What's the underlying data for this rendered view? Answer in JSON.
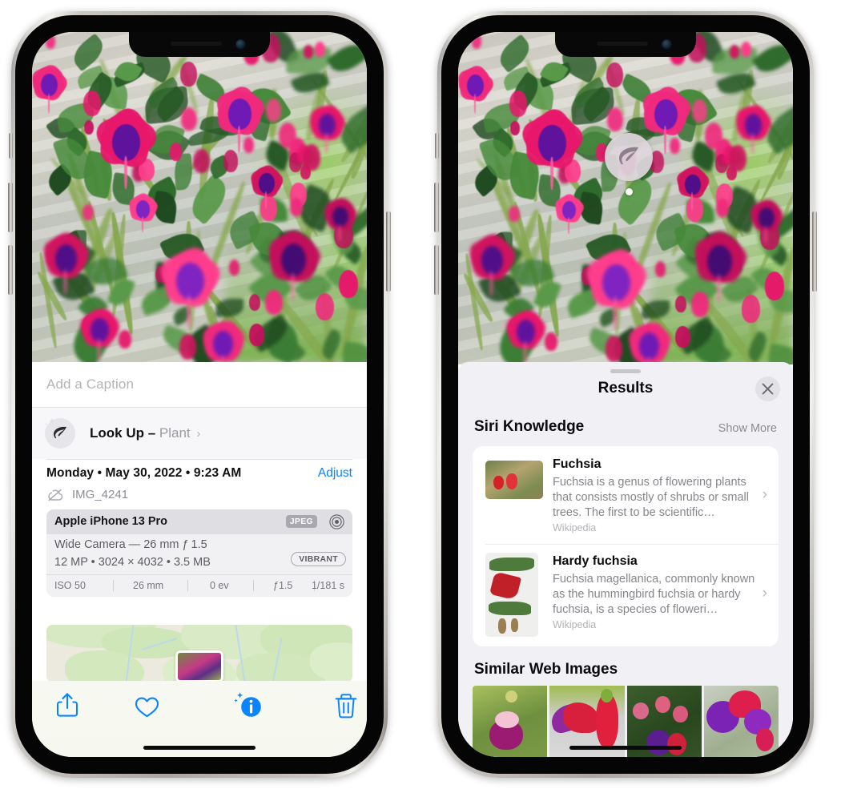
{
  "left_phone": {
    "name": "iPhone photo detail view",
    "caption": {
      "placeholder": "Add a Caption",
      "value": ""
    },
    "lookup": {
      "icon": "leaf-icon",
      "label": "Look Up –",
      "subject": "Plant",
      "chevron": "›"
    },
    "meta": {
      "date_line": "Monday • May 30, 2022 • 9:23 AM",
      "adjust_label": "Adjust",
      "filename": "IMG_4241",
      "cloud_icon": "cloud-slash-icon"
    },
    "camera_card": {
      "device": "Apple iPhone 13 Pro",
      "format_badge": "JPEG",
      "raw_icon": "raw-aperture-icon",
      "lens_line": "Wide Camera — 26 mm ƒ 1.5",
      "size_line": "12 MP • 3024 × 4032 • 3.5 MB",
      "style_badge": "VIBRANT",
      "exif": [
        "ISO 50",
        "26 mm",
        "0 ev",
        "ƒ1.5",
        "1/181 s"
      ]
    },
    "map": {
      "pin_label": "photo-location-thumbnail"
    },
    "toolbar": [
      {
        "name": "share-button",
        "icon": "share-icon"
      },
      {
        "name": "favorite-button",
        "icon": "heart-icon"
      },
      {
        "name": "info-button",
        "icon": "info-sparkle-icon"
      },
      {
        "name": "delete-button",
        "icon": "trash-icon"
      }
    ]
  },
  "right_phone": {
    "name": "Visual Look Up results sheet",
    "badge": {
      "icon": "leaf-icon"
    },
    "sheet": {
      "title": "Results",
      "close_icon": "close-icon"
    },
    "siri_knowledge": {
      "heading": "Siri Knowledge",
      "action": "Show More",
      "items": [
        {
          "title": "Fuchsia",
          "description": "Fuchsia is a genus of flowering plants that consists mostly of shrubs or small trees. The first to be scientific…",
          "source": "Wikipedia",
          "chevron": "›"
        },
        {
          "title": "Hardy fuchsia",
          "description": "Fuchsia magellanica, commonly known as the hummingbird fuchsia or hardy fuchsia, is a species of floweri…",
          "source": "Wikipedia",
          "chevron": "›"
        }
      ]
    },
    "similar_web_images": {
      "heading": "Similar Web Images",
      "count": 4
    }
  },
  "colors": {
    "accent_blue": "#0a84ff",
    "sheet_bg": "#f1f1f5",
    "card_bg": "#ffffff",
    "muted_text": "#85858b"
  }
}
